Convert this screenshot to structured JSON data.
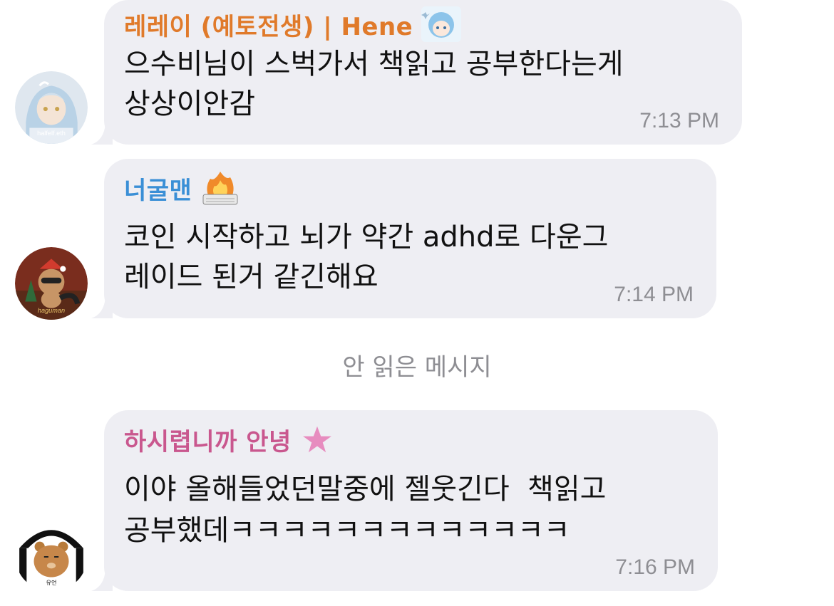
{
  "messages": [
    {
      "sender": "레레이 (예토전생) | Hene",
      "sender_color": "#e07a2a",
      "avatar_text": "halfelf.eth",
      "text": "으수비님이 스벅가서 책읽고 공부한다는게\n상상이안감",
      "time": "7:13 PM"
    },
    {
      "sender": "너굴맨",
      "sender_color": "#3a8fd6",
      "avatar_text": "haguman",
      "text": "코인 시작하고 뇌가 약간 adhd로 다운그\n레이드 된거 같긴해요",
      "time": "7:14 PM"
    },
    {
      "sender": "하시렵니까 안녕",
      "sender_color": "#c9578e",
      "avatar_text": "유언",
      "text": "이야 올해들었던말중에 젤웃긴다  책읽고\n공부했데ㅋㅋㅋㅋㅋㅋㅋㅋㅋㅋㅋㅋㅋ",
      "time": "7:16 PM"
    }
  ],
  "unread_divider": "안 읽은 메시지"
}
